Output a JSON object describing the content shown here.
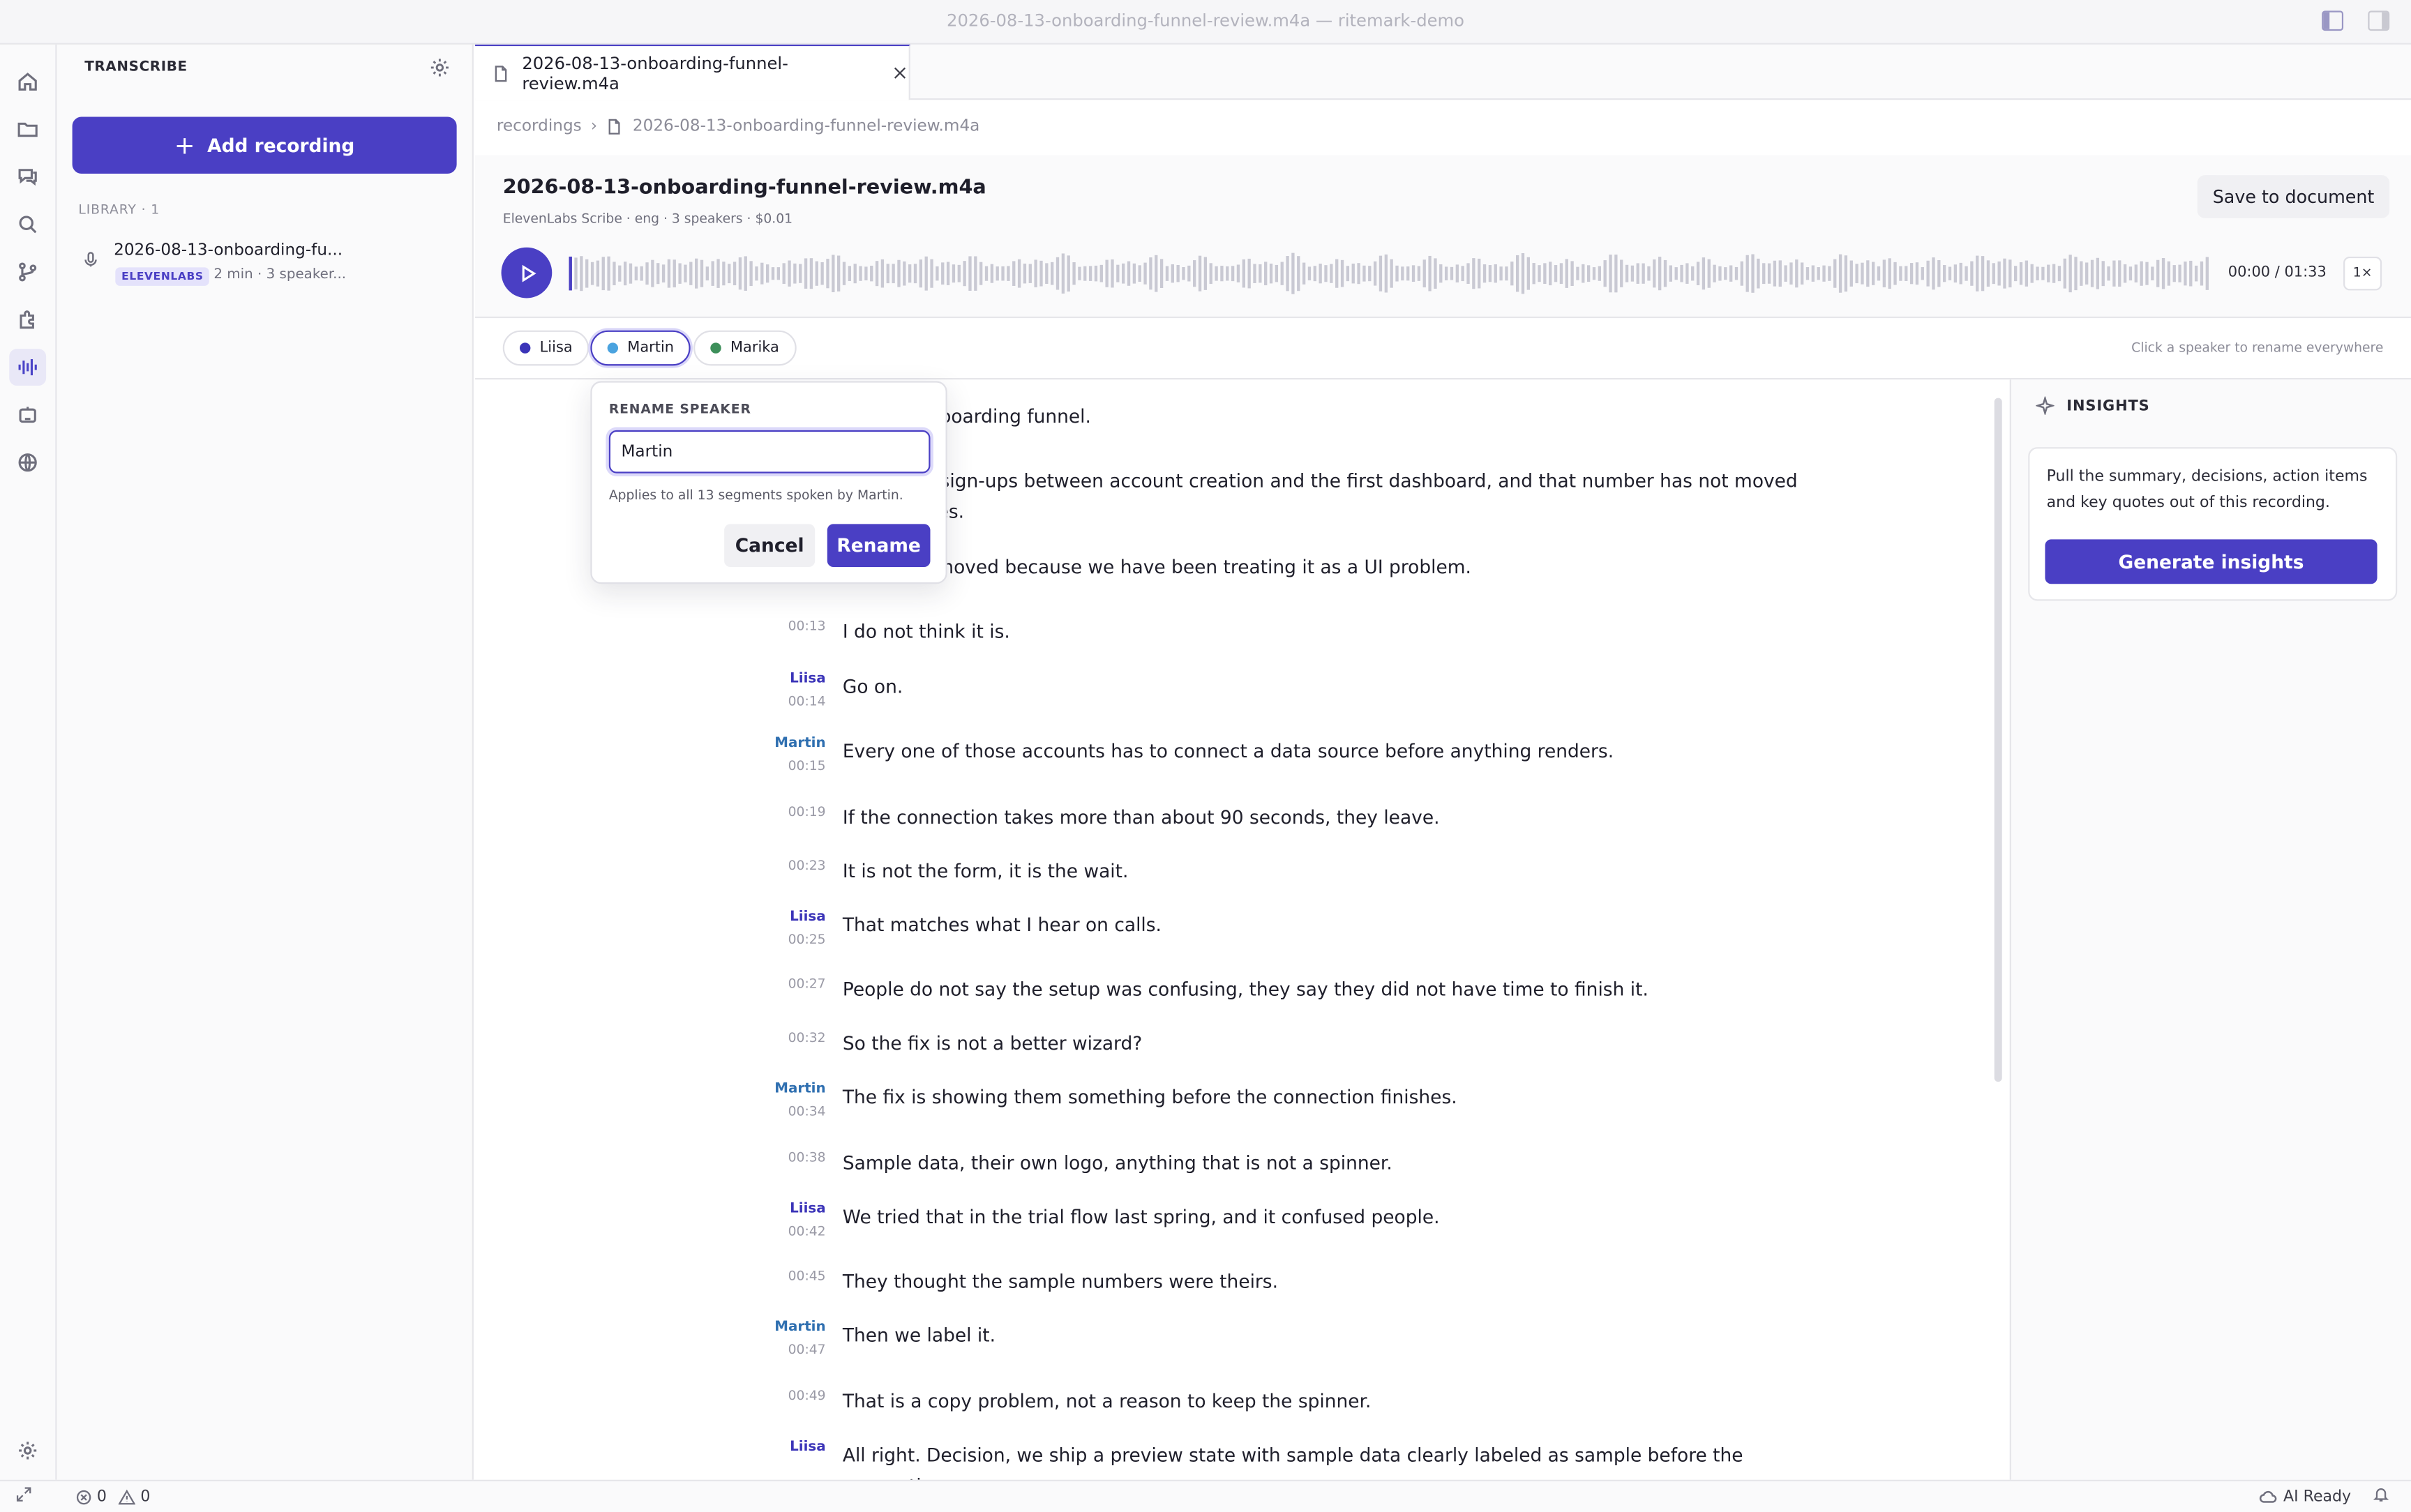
{
  "window": {
    "title": "2026-08-13-onboarding-funnel-review.m4a — ritemark-demo"
  },
  "sidebar": {
    "title": "TRANSCRIBE",
    "add_label": "Add recording",
    "library_label": "LIBRARY",
    "library_count": "· 1",
    "items": [
      {
        "name": "2026-08-13-onboarding-fu...",
        "badge": "ELEVENLABS",
        "meta": "2 min · 3 speaker..."
      }
    ]
  },
  "tab": {
    "label": "2026-08-13-onboarding-funnel-review.m4a"
  },
  "breadcrumb": {
    "root": "recordings",
    "file": "2026-08-13-onboarding-funnel-review.m4a"
  },
  "recording": {
    "title": "2026-08-13-onboarding-funnel-review.m4a",
    "subtitle": "ElevenLabs Scribe · eng · 3 speakers · $0.01",
    "save_label": "Save to document",
    "time": "00:00 / 01:33",
    "speed": "1×",
    "progress": 0
  },
  "speakers": {
    "chips": [
      {
        "name": "Liisa",
        "color": "#3b34b8"
      },
      {
        "name": "Martin",
        "color": "#4aa3df"
      },
      {
        "name": "Marika",
        "color": "#3d8f5a"
      }
    ],
    "hint": "Click a speaker to rename everywhere"
  },
  "transcript": [
    {
      "speaker": "",
      "time": "",
      "text": "onboarding funnel."
    },
    {
      "speaker": "",
      "time": "",
      "text": "of sign-ups between account creation and the first dashboard, and that number has not moved"
    },
    {
      "speaker": "",
      "time": "",
      "text": "ases."
    },
    {
      "speaker": "",
      "time": "00:09",
      "text": "It has not moved because we have been treating it as a UI problem."
    },
    {
      "speaker": "",
      "time": "00:13",
      "text": "I do not think it is."
    },
    {
      "speaker": "Liisa",
      "time": "00:14",
      "text": "Go on."
    },
    {
      "speaker": "Martin",
      "time": "00:15",
      "text": "Every one of those accounts has to connect a data source before anything renders."
    },
    {
      "speaker": "",
      "time": "00:19",
      "text": "If the connection takes more than about 90 seconds, they leave."
    },
    {
      "speaker": "",
      "time": "00:23",
      "text": "It is not the form, it is the wait."
    },
    {
      "speaker": "Liisa",
      "time": "00:25",
      "text": "That matches what I hear on calls."
    },
    {
      "speaker": "",
      "time": "00:27",
      "text": "People do not say the setup was confusing, they say they did not have time to finish it."
    },
    {
      "speaker": "",
      "time": "00:32",
      "text": "So the fix is not a better wizard?"
    },
    {
      "speaker": "Martin",
      "time": "00:34",
      "text": "The fix is showing them something before the connection finishes."
    },
    {
      "speaker": "",
      "time": "00:38",
      "text": "Sample data, their own logo, anything that is not a spinner."
    },
    {
      "speaker": "Liisa",
      "time": "00:42",
      "text": "We tried that in the trial flow last spring, and it confused people."
    },
    {
      "speaker": "",
      "time": "00:45",
      "text": "They thought the sample numbers were theirs."
    },
    {
      "speaker": "Martin",
      "time": "00:47",
      "text": "Then we label it."
    },
    {
      "speaker": "",
      "time": "00:49",
      "text": "That is a copy problem, not a reason to keep the spinner."
    },
    {
      "speaker": "Liisa",
      "time": "",
      "text": "All right. Decision, we ship a preview state with sample data clearly labeled as sample before the connection"
    }
  ],
  "rename": {
    "label": "RENAME SPEAKER",
    "value": "Martin",
    "hint": "Applies to all 13 segments spoken by Martin.",
    "cancel": "Cancel",
    "confirm": "Rename"
  },
  "insights": {
    "title": "INSIGHTS",
    "description": "Pull the summary, decisions, action items and key quotes out of this recording.",
    "button": "Generate insights"
  },
  "status": {
    "errors": "0",
    "warnings": "0",
    "ai": "AI Ready"
  },
  "colors": {
    "accent": "#4a3fc4",
    "martin": "#2f6fb0",
    "liisa": "#3b34b8"
  }
}
